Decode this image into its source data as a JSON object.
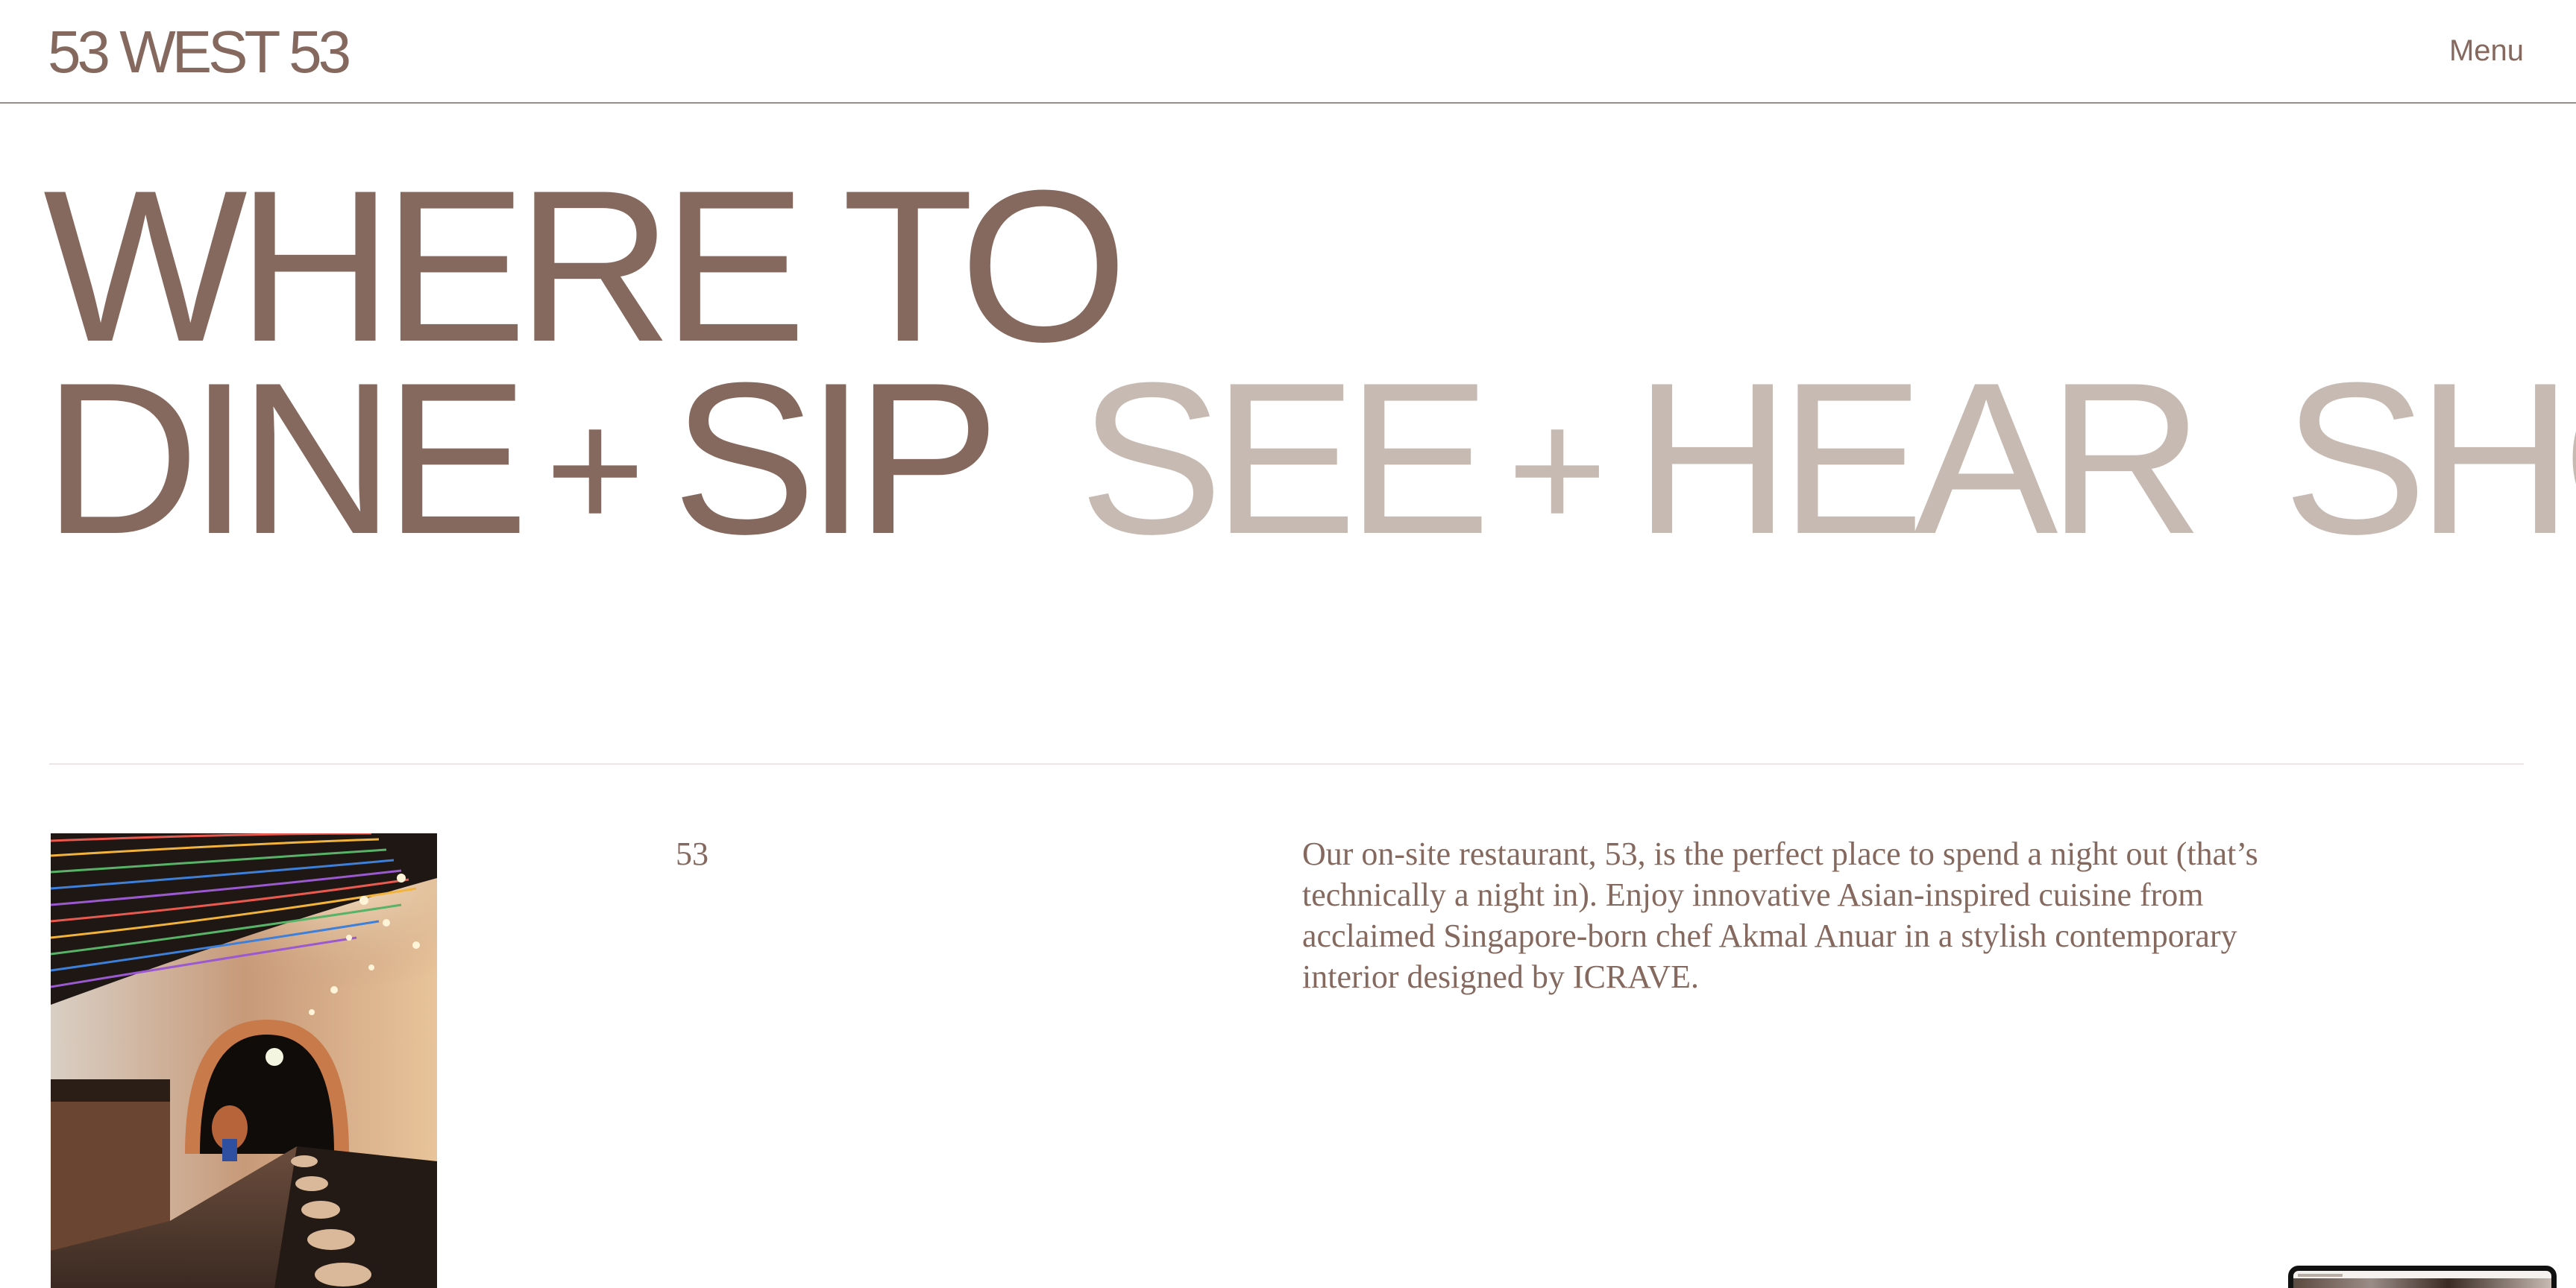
{
  "header": {
    "logo_text": "53 WEST 53",
    "menu_label": "Menu"
  },
  "headline": {
    "line1": "WHERE TO",
    "tabs": [
      {
        "left": "DINE",
        "plus": "+",
        "right": "SIP",
        "state": "active"
      },
      {
        "left": "SEE",
        "plus": "+",
        "right": "HEAR",
        "state": "inactive"
      },
      {
        "left": "SHO",
        "plus": "",
        "right": "",
        "state": "inactive"
      }
    ]
  },
  "content": {
    "venue_name": "53",
    "description": "Our on-site restaurant, 53, is the perfect place to spend a night out (that’s technically a night in). Enjoy innovative Asian-inspired cuisine from acclaimed Singapore-born chef Akmal Anuar in a stylish contemporary interior designed by ICRAVE.",
    "image_subject": "restaurant-bar-interior-photo"
  },
  "colors": {
    "brand_brown": "#86695e",
    "inactive_tab": "#c7bab3",
    "divider": "#ebe6e3",
    "background": "#ffffff"
  }
}
